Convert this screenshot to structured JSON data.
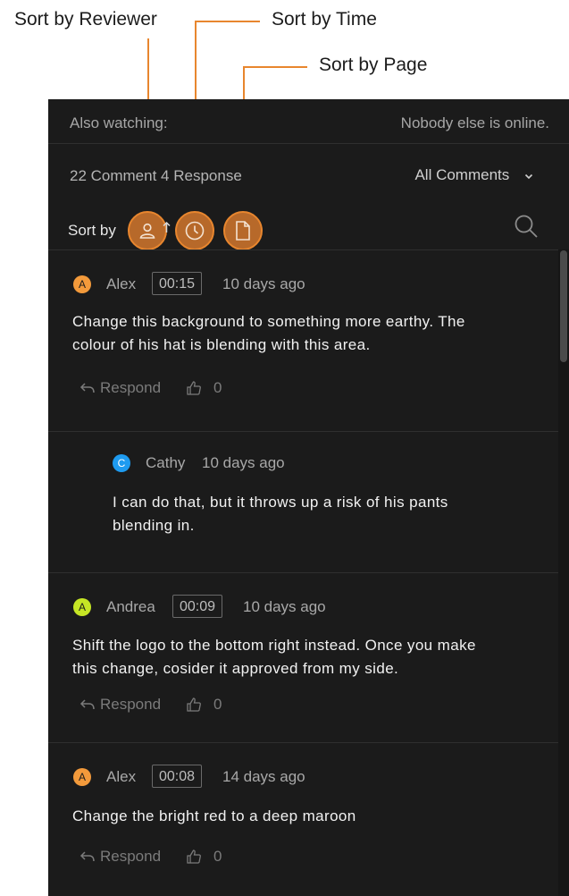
{
  "callouts": {
    "sort_reviewer": "Sort by Reviewer",
    "sort_time": "Sort by Time",
    "sort_page": "Sort by Page"
  },
  "header": {
    "also_watching": "Also watching:",
    "online_status": "Nobody else is online.",
    "count_summary": "22 Comment 4 Response",
    "filter_label": "All Comments",
    "sort_by_label": "Sort by"
  },
  "colors": {
    "accent": "#e8862e",
    "panel_bg": "#1b1b1b",
    "avatar_orange": "#f39a3b",
    "avatar_blue": "#1e9bf0",
    "avatar_lime": "#c6e625"
  },
  "comments": [
    {
      "initial": "A",
      "author": "Alex",
      "timecode": "00:15",
      "age": "10 days ago",
      "text_line1": "Change this background to something more earthy. The",
      "text_line2": "colour of his hat is blending with this area.",
      "respond_label": "Respond",
      "likes": "0"
    },
    {
      "initial": "C",
      "author": "Cathy",
      "age": "10 days ago",
      "text_line1": "I can do that, but it throws up a risk of his pants",
      "text_line2": "blending in."
    },
    {
      "initial": "A",
      "author": "Andrea",
      "timecode": "00:09",
      "age": "10 days ago",
      "text_line1": "Shift the logo to the bottom right instead. Once you make",
      "text_line2": "this change, cosider it approved from my side.",
      "respond_label": "Respond",
      "likes": "0"
    },
    {
      "initial": "A",
      "author": "Alex",
      "timecode": "00:08",
      "age": "14 days ago",
      "text_line1": "Change the bright red to a deep maroon",
      "respond_label": "Respond",
      "likes": "0"
    }
  ]
}
